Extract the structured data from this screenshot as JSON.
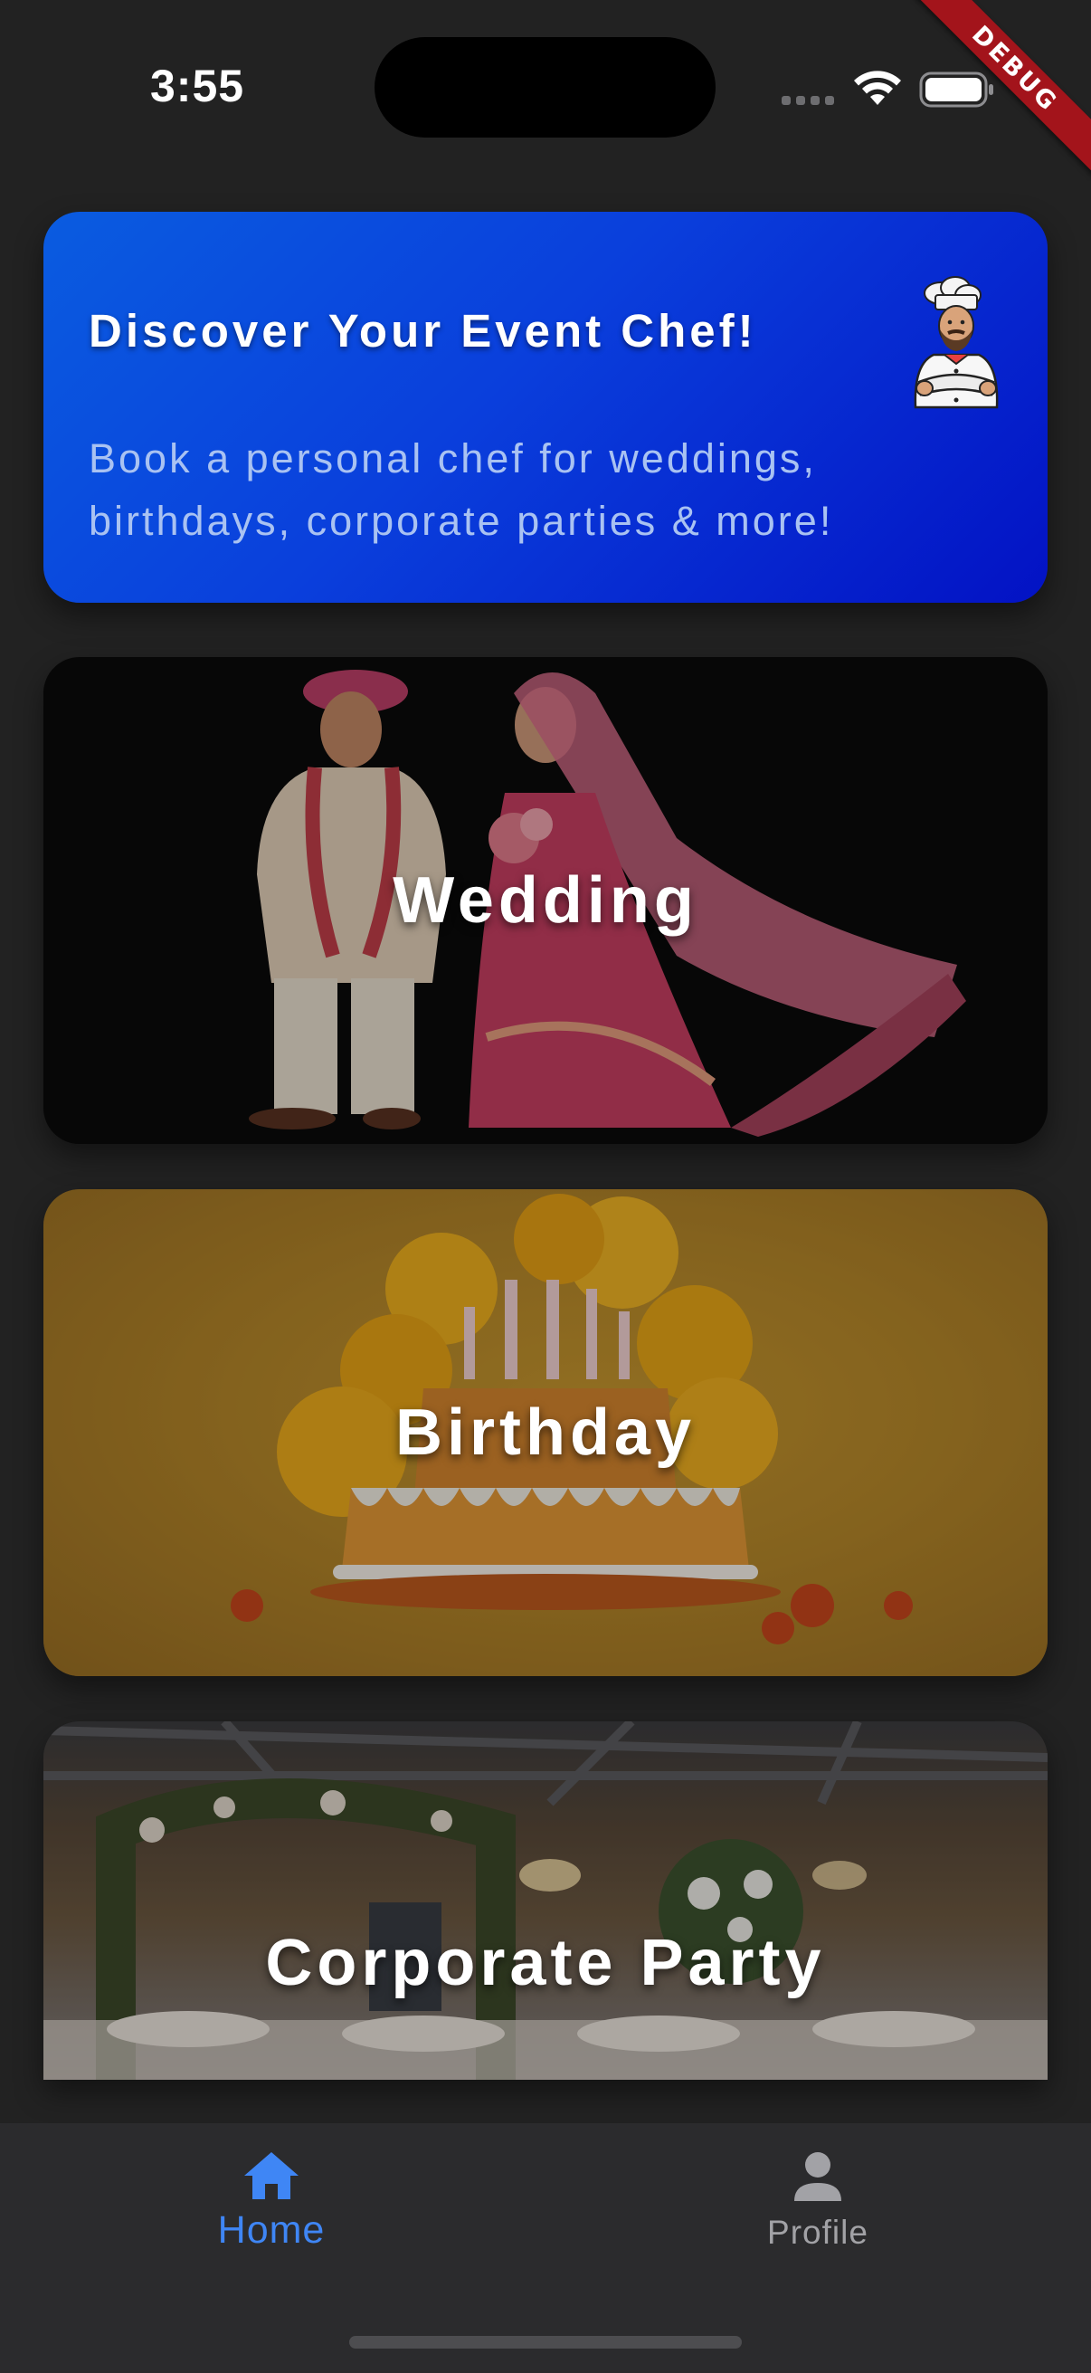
{
  "status_bar": {
    "time": "3:55",
    "icons": [
      "signal-dots-icon",
      "wifi-icon",
      "battery-icon"
    ]
  },
  "debug_banner": "DEBUG",
  "promo": {
    "title": "Discover Your Event Chef!",
    "subtitle": "Book a personal chef for weddings, birthdays, corporate parties & more!",
    "icon": "chef-icon",
    "gradient": [
      "#0a5ce0",
      "#0312c4"
    ]
  },
  "events": [
    {
      "label": "Wedding",
      "image": "wedding-couple-illustration"
    },
    {
      "label": "Birthday",
      "image": "birthday-cake-balloons-illustration"
    },
    {
      "label": "Corporate Party",
      "image": "banquet-hall-photo"
    }
  ],
  "bottom_nav": {
    "items": [
      {
        "label": "Home",
        "icon": "home-icon",
        "active": true
      },
      {
        "label": "Profile",
        "icon": "person-icon",
        "active": false
      }
    ],
    "active_color": "#3f86f5",
    "inactive_color": "#a2a2a6"
  }
}
